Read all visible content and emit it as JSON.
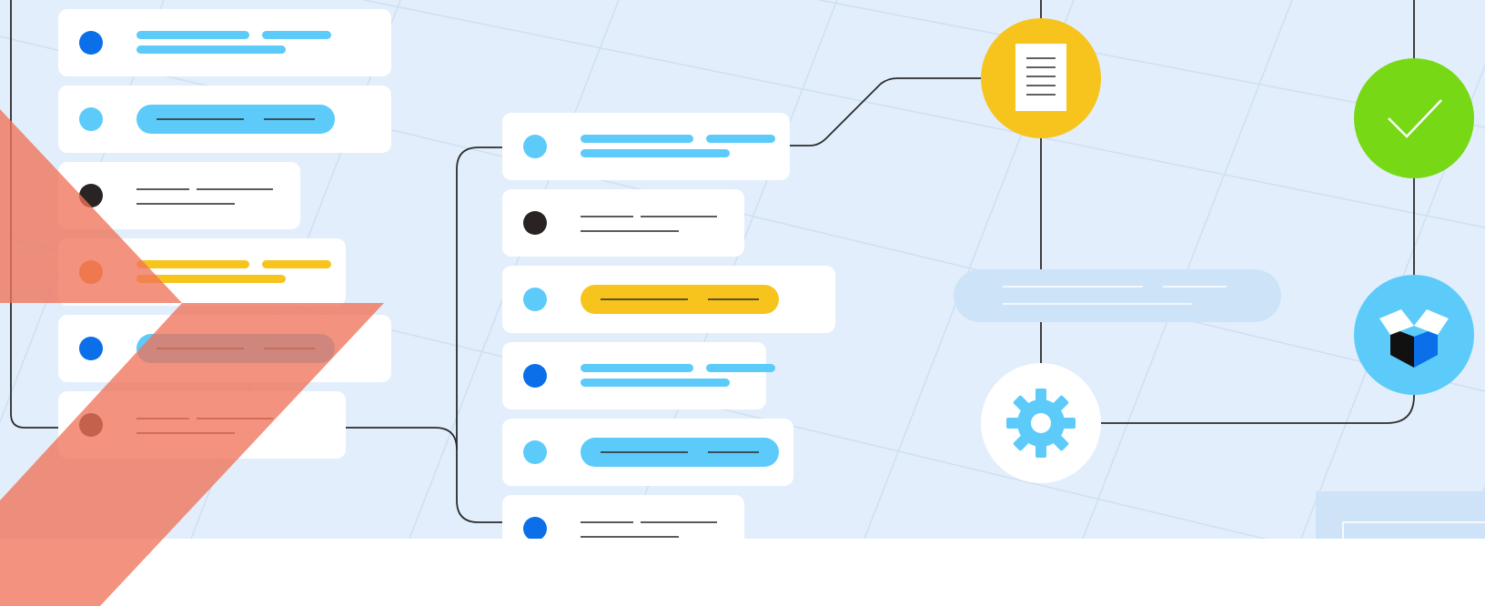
{
  "colors": {
    "background": "#e2eefb",
    "grid": "#cfdff2",
    "card": "#ffffff",
    "connector": "#2b2b2b",
    "blue_dark": "#0a6fe8",
    "blue_light": "#5ccbfa",
    "black": "#2a2323",
    "orange": "#f2892b",
    "yellow": "#f6c41c",
    "green": "#77d915",
    "accent_overlay": "#f0735a",
    "chip_pale": "#cde4f8"
  },
  "left_column": {
    "cards": [
      {
        "dot": "blue_dark",
        "style": "lines",
        "tone": "blue_light"
      },
      {
        "dot": "blue_light",
        "style": "pill",
        "tone": "blue_light"
      },
      {
        "dot": "black",
        "style": "thin",
        "tone": "black"
      },
      {
        "dot": "orange",
        "style": "lines",
        "tone": "yellow"
      },
      {
        "dot": "blue_dark",
        "style": "pill",
        "tone": "blue_light"
      },
      {
        "dot": "black",
        "style": "thin",
        "tone": "black"
      }
    ]
  },
  "middle_column": {
    "cards": [
      {
        "dot": "blue_light",
        "style": "lines",
        "tone": "blue_light"
      },
      {
        "dot": "black",
        "style": "thin",
        "tone": "black"
      },
      {
        "dot": "blue_light",
        "style": "pill",
        "tone": "yellow"
      },
      {
        "dot": "blue_dark",
        "style": "lines",
        "tone": "blue_light"
      },
      {
        "dot": "blue_light",
        "style": "pill",
        "tone": "blue_light"
      },
      {
        "dot": "blue_dark",
        "style": "thin",
        "tone": "black"
      }
    ]
  },
  "nodes": [
    {
      "icon": "document-icon",
      "color": "yellow"
    },
    {
      "icon": "gear-icon",
      "color": "blue_light"
    },
    {
      "icon": "checkmark-icon",
      "color": "green"
    },
    {
      "icon": "box-icon",
      "color": "blue_light"
    }
  ]
}
